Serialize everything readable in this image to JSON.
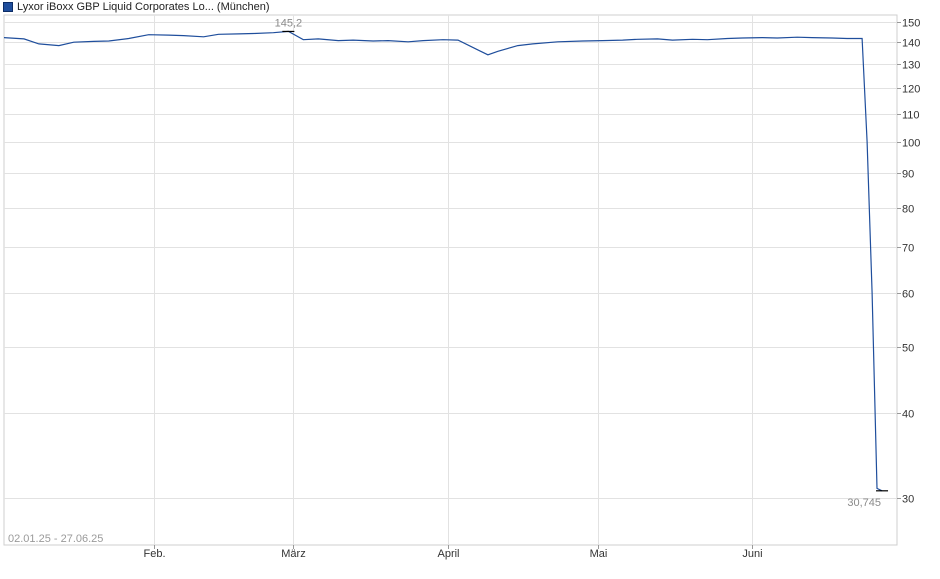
{
  "legend": {
    "label": "Lyxor iBoxx GBP Liquid Corporates Lo... (München)",
    "color": "#1f4e9c"
  },
  "chart_data": {
    "type": "line",
    "title": "",
    "xlabel": "",
    "ylabel": "",
    "y_scale": "log",
    "ylim": [
      25.6,
      153.5
    ],
    "y_ticks": [
      30,
      40,
      50,
      60,
      70,
      80,
      90,
      100,
      110,
      120,
      130,
      140,
      150
    ],
    "x_ticks": [
      {
        "label": "Feb.",
        "date": "2025-02-01"
      },
      {
        "label": "März",
        "date": "2025-03-01"
      },
      {
        "label": "April",
        "date": "2025-04-01"
      },
      {
        "label": "Mai",
        "date": "2025-05-01"
      },
      {
        "label": "Juni",
        "date": "2025-06-01"
      }
    ],
    "range_label": "02.01.25 - 27.06.25",
    "annotations": [
      {
        "label": "145,2",
        "date": "2025-02-28",
        "value": 145.2
      },
      {
        "label": "30,745",
        "date": "2025-06-27",
        "value": 30.745
      }
    ],
    "grid": true,
    "legend_position": "top-left",
    "series": [
      {
        "name": "Lyxor iBoxx GBP Liquid Corporates Lo... (München)",
        "color": "#1f4e9c",
        "x": [
          "2025-01-02",
          "2025-01-06",
          "2025-01-09",
          "2025-01-13",
          "2025-01-16",
          "2025-01-20",
          "2025-01-23",
          "2025-01-27",
          "2025-01-31",
          "2025-02-04",
          "2025-02-07",
          "2025-02-11",
          "2025-02-14",
          "2025-02-18",
          "2025-02-21",
          "2025-02-25",
          "2025-02-28",
          "2025-03-03",
          "2025-03-06",
          "2025-03-10",
          "2025-03-13",
          "2025-03-17",
          "2025-03-20",
          "2025-03-24",
          "2025-03-27",
          "2025-03-31",
          "2025-04-03",
          "2025-04-07",
          "2025-04-09",
          "2025-04-11",
          "2025-04-15",
          "2025-04-18",
          "2025-04-23",
          "2025-04-28",
          "2025-05-02",
          "2025-05-06",
          "2025-05-09",
          "2025-05-13",
          "2025-05-16",
          "2025-05-20",
          "2025-05-23",
          "2025-05-27",
          "2025-05-30",
          "2025-06-03",
          "2025-06-06",
          "2025-06-10",
          "2025-06-13",
          "2025-06-17",
          "2025-06-20",
          "2025-06-23",
          "2025-06-24",
          "2025-06-25",
          "2025-06-26",
          "2025-06-27"
        ],
        "values": [
          142.2,
          141.6,
          139.2,
          138.4,
          140.0,
          140.4,
          140.6,
          141.8,
          143.6,
          143.4,
          143.2,
          142.6,
          143.8,
          144.0,
          144.2,
          144.6,
          145.2,
          141.2,
          141.6,
          140.8,
          141.0,
          140.6,
          140.8,
          140.2,
          140.8,
          141.2,
          141.0,
          136.4,
          134.2,
          135.8,
          138.4,
          139.2,
          140.2,
          140.6,
          140.8,
          141.0,
          141.4,
          141.6,
          141.0,
          141.4,
          141.2,
          141.8,
          142.0,
          142.2,
          142.0,
          142.4,
          142.2,
          142.0,
          141.8,
          141.8,
          100.0,
          60.0,
          31.0,
          30.745
        ]
      }
    ]
  }
}
